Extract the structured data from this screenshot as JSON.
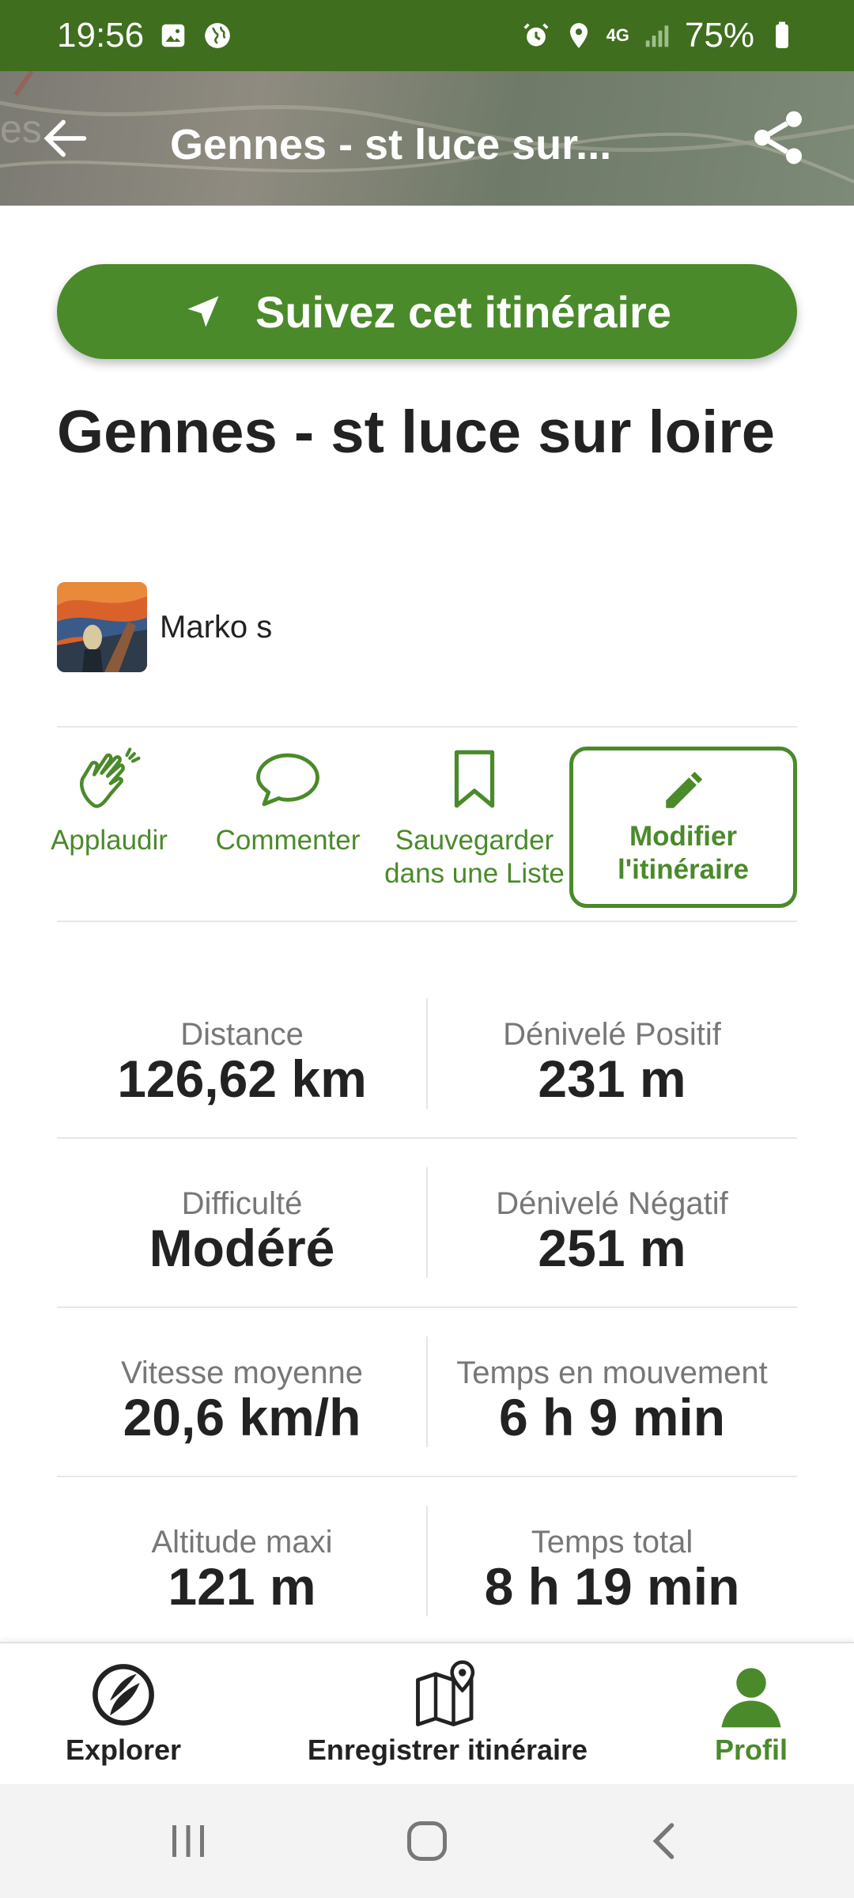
{
  "status_bar": {
    "time": "19:56",
    "battery": "75%",
    "network": "4G"
  },
  "header": {
    "title": "Gennes - st luce sur...",
    "back_icon": "arrow-left-icon",
    "share_icon": "share-icon"
  },
  "follow_button": {
    "label": "Suivez cet itinéraire",
    "icon": "navigation-arrow-icon"
  },
  "route": {
    "title": "Gennes - st luce sur loire",
    "author": "Marko s"
  },
  "actions": [
    {
      "label": "Applaudir",
      "icon": "clap-icon"
    },
    {
      "label": "Commenter",
      "icon": "comment-icon"
    },
    {
      "label": "Sauvegarder dans une Liste",
      "icon": "bookmark-icon"
    },
    {
      "label": "Modifier l'itinéraire",
      "icon": "pencil-icon"
    }
  ],
  "stats": [
    {
      "left": {
        "label": "Distance",
        "value": "126,62 km"
      },
      "right": {
        "label": "Dénivelé Positif",
        "value": "231 m"
      }
    },
    {
      "left": {
        "label": "Difficulté",
        "value": "Modéré"
      },
      "right": {
        "label": "Dénivelé Négatif",
        "value": "251 m"
      }
    },
    {
      "left": {
        "label": "Vitesse moyenne",
        "value": "20,6 km/h"
      },
      "right": {
        "label": "Temps en mouvement",
        "value": "6 h 9 min"
      }
    },
    {
      "left": {
        "label": "Altitude maxi",
        "value": "121 m"
      },
      "right": {
        "label": "Temps total",
        "value": "8 h 19 min"
      }
    }
  ],
  "bottom_nav": [
    {
      "label": "Explorer",
      "icon": "explore-compass-icon",
      "active": false
    },
    {
      "label": "Enregistrer itinéraire",
      "icon": "map-pin-icon",
      "active": false
    },
    {
      "label": "Profil",
      "icon": "profile-icon",
      "active": true
    }
  ],
  "colors": {
    "brand_green": "#4a8a2a",
    "status_bar": "#3f6e1e"
  }
}
